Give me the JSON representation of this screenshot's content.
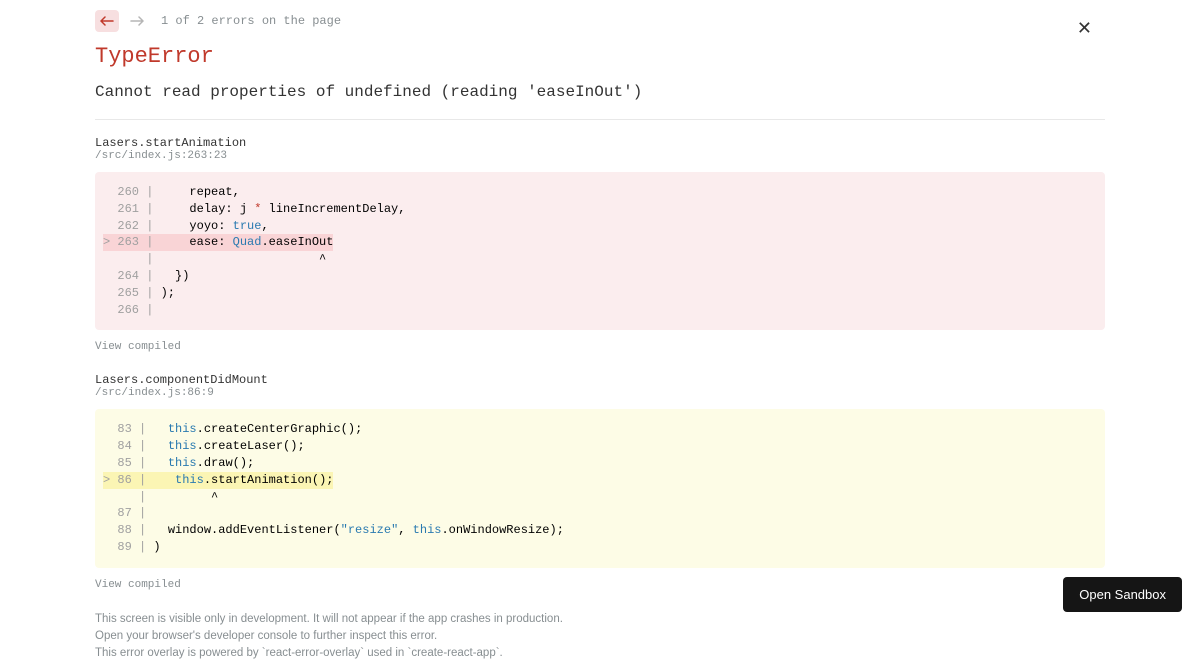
{
  "nav": {
    "count_text": "1 of 2 errors on the page"
  },
  "error": {
    "type": "TypeError",
    "message": "Cannot read properties of undefined (reading 'easeInOut')"
  },
  "frames": [
    {
      "fn": "Lasers.startAnimation",
      "loc": "/src/index.js:263:23",
      "style": "red",
      "lines": [
        {
          "n": "  260",
          "pre": "    repeat,",
          "hl": false
        },
        {
          "n": "  261",
          "pre": "    delay: j ",
          "tok_red": "*",
          "post": " lineIncrementDelay,",
          "hl": false
        },
        {
          "n": "  262",
          "pre": "    yoyo: ",
          "tok_blue": "true",
          "post": ",",
          "hl": false
        },
        {
          "n": "> 263",
          "pre": "    ease: ",
          "tok_blue": "Quad",
          "post": ".easeInOut",
          "hl": true,
          "marker": ">"
        },
        {
          "n": "     ",
          "pre": "                      ^",
          "hl": false,
          "caret": true
        },
        {
          "n": "  264",
          "pre": "  })",
          "hl": false
        },
        {
          "n": "  265",
          "pre": ");",
          "hl": false
        },
        {
          "n": "  266",
          "pre": "",
          "hl": false
        }
      ],
      "view_compiled": "View compiled"
    },
    {
      "fn": "Lasers.componentDidMount",
      "loc": "/src/index.js:86:9",
      "style": "yellow",
      "lines": [
        {
          "n": "  83",
          "pre": "  ",
          "tok_blue": "this",
          "post": ".createCenterGraphic();",
          "hl": false
        },
        {
          "n": "  84",
          "pre": "  ",
          "tok_blue": "this",
          "post": ".createLaser();",
          "hl": false
        },
        {
          "n": "  85",
          "pre": "  ",
          "tok_blue": "this",
          "post": ".draw();",
          "hl": false
        },
        {
          "n": "> 86",
          "pre": "   ",
          "tok_blue": "this",
          "post": ".startAnimation();",
          "hl": true,
          "marker": ">"
        },
        {
          "n": "    ",
          "pre": "        ^",
          "hl": false,
          "caret": true
        },
        {
          "n": "  87",
          "pre": "",
          "hl": false
        },
        {
          "n": "  88",
          "pre": "  window.addEventListener(",
          "tok_str": "\"resize\"",
          "mid": ", ",
          "tok_blue2": "this",
          "post": ".onWindowResize);",
          "hl": false
        },
        {
          "n": "  89",
          "pre": ")",
          "hl": false
        }
      ],
      "view_compiled": "View compiled"
    }
  ],
  "footer": {
    "l1": "This screen is visible only in development. It will not appear if the app crashes in production.",
    "l2": "Open your browser's developer console to further inspect this error.",
    "l3": "This error overlay is powered by `react-error-overlay` used in `create-react-app`."
  },
  "sandbox_button": "Open Sandbox"
}
